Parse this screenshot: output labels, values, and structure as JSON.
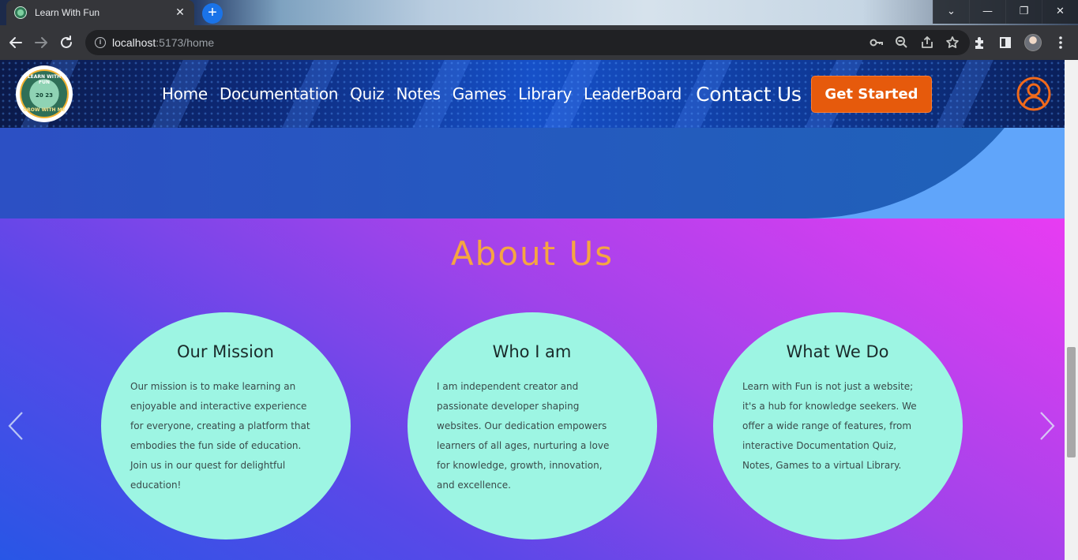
{
  "browser": {
    "tab_title": "Learn With Fun",
    "tab_close": "✕",
    "new_tab": "+",
    "url_host": "localhost",
    "url_path": ":5173/home",
    "window_controls": [
      "⌄",
      "—",
      "❐",
      "✕"
    ]
  },
  "logo": {
    "top_text": "LEARN WITH FUN",
    "year": "20  23",
    "bottom_text": "GROW WITH ME"
  },
  "nav": {
    "links": [
      "Home",
      "Documentation",
      "Quiz",
      "Notes",
      "Games",
      "Library",
      "LeaderBoard"
    ],
    "contact": "Contact Us",
    "cta": "Get Started"
  },
  "about": {
    "title": "About Us",
    "cards": [
      {
        "title": "Our Mission",
        "text": "Our mission is to make learning an enjoyable and interactive experience for everyone, creating a platform that embodies the fun side of education. Join us in our quest for delightful education!"
      },
      {
        "title": "Who I am",
        "text": "I am independent creator and passionate developer shaping websites. Our dedication empowers learners of all ages, nurturing a love for knowledge, growth, innovation, and excellence."
      },
      {
        "title": "What We Do",
        "text": "Learn with Fun is not just a website; it's a hub for knowledge seekers. We offer a wide range of features, from interactive Documentation Quiz, Notes, Games to a virtual Library."
      }
    ]
  },
  "colors": {
    "accent_orange": "#e65a0c",
    "about_title": "#f5a542",
    "card_bg": "#9df5e3"
  }
}
